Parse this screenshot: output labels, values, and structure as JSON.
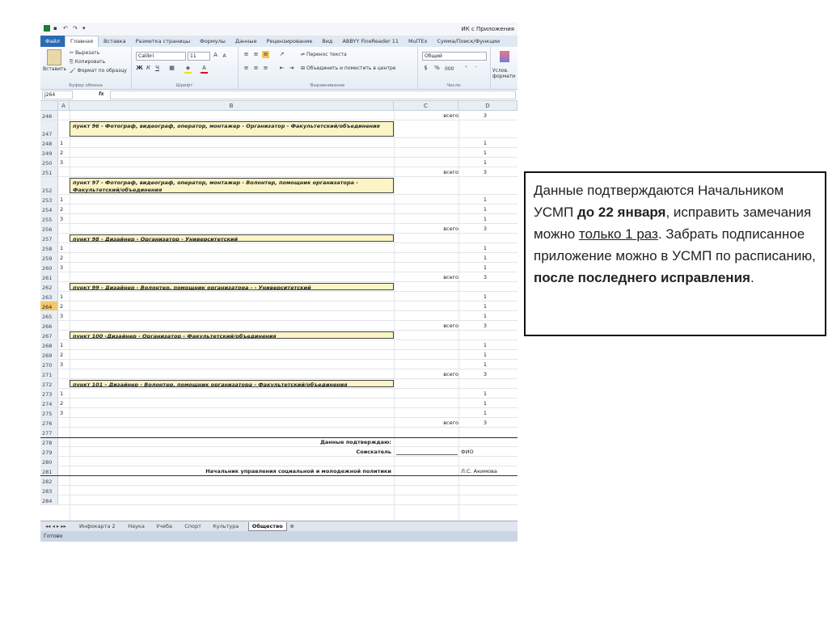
{
  "window": {
    "title": "ИК с Приложения"
  },
  "ribbon": {
    "tabs": [
      "Файл",
      "Главная",
      "Вставка",
      "Разметка страницы",
      "Формулы",
      "Данные",
      "Рецензирование",
      "Вид",
      "ABBYY FineReader 11",
      "MulTEx",
      "Сумма/Поиск/Функции"
    ],
    "active_tab": 1,
    "clipboard": {
      "paste": "Вставить",
      "cut": "Вырезать",
      "copy": "Копировать",
      "format_painter": "Формат по образцу",
      "group": "Буфер обмена"
    },
    "font": {
      "name": "Calibri",
      "size": "11",
      "group": "Шрифт"
    },
    "alignment": {
      "wrap": "Перенос текста",
      "merge": "Объединить и поместить в центре",
      "group": "Выравнивание"
    },
    "number": {
      "format": "Общий",
      "group": "Число",
      "percent": "%",
      "thousands": "000"
    },
    "styles": {
      "label": "Услов. формати"
    }
  },
  "formula_bar": {
    "cell_ref": "J264",
    "fx": "fx"
  },
  "columns": [
    "A",
    "B",
    "C",
    "D"
  ],
  "rows": [
    {
      "n": "246",
      "c": "всего",
      "d": "3"
    },
    {
      "n": "247",
      "hdr": "пункт 96 - Фотограф, видеограф, оператор, монтажер - Организатор - Факультетский/объединения",
      "tall": true
    },
    {
      "n": "248",
      "a": "1",
      "d": "1"
    },
    {
      "n": "249",
      "a": "2",
      "d": "1"
    },
    {
      "n": "250",
      "a": "3",
      "d": "1"
    },
    {
      "n": "251",
      "c": "всего",
      "d": "3"
    },
    {
      "n": "252",
      "hdr": "пункт 97 - Фотограф, видеограф, оператор, монтажер - Волонтер, помощник организатора - Факультетский/объединения",
      "tall": true
    },
    {
      "n": "253",
      "a": "1",
      "d": "1"
    },
    {
      "n": "254",
      "a": "2",
      "d": "1"
    },
    {
      "n": "255",
      "a": "3",
      "d": "1"
    },
    {
      "n": "256",
      "c": "всего",
      "d": "3"
    },
    {
      "n": "257",
      "hdr": "пункт 98 - Дизайнер - Организатор - Университетский"
    },
    {
      "n": "258",
      "a": "1",
      "d": "1"
    },
    {
      "n": "259",
      "a": "2",
      "d": "1"
    },
    {
      "n": "260",
      "a": "3",
      "d": "1"
    },
    {
      "n": "261",
      "c": "всего",
      "d": "3"
    },
    {
      "n": "262",
      "hdr": "пункт 99 - Дизайнер - Волонтер, помощник организатора - - Университетский"
    },
    {
      "n": "263",
      "a": "1",
      "d": "1"
    },
    {
      "n": "264",
      "a": "2",
      "d": "1",
      "sel": true
    },
    {
      "n": "265",
      "a": "3",
      "d": "1"
    },
    {
      "n": "266",
      "c": "всего",
      "d": "3"
    },
    {
      "n": "267",
      "hdr": "пункт 100 -Дизайнер - Организатор - Факультетский/объединения"
    },
    {
      "n": "268",
      "a": "1",
      "d": "1"
    },
    {
      "n": "269",
      "a": "2",
      "d": "1"
    },
    {
      "n": "270",
      "a": "3",
      "d": "1"
    },
    {
      "n": "271",
      "c": "всего",
      "d": "3"
    },
    {
      "n": "272",
      "hdr": "пункт 101 - Дизайнер - Волонтер, помощник организатора - Факультетский/объединения"
    },
    {
      "n": "273",
      "a": "1",
      "d": "1"
    },
    {
      "n": "274",
      "a": "2",
      "d": "1"
    },
    {
      "n": "275",
      "a": "3",
      "d": "1"
    },
    {
      "n": "276",
      "c": "всего",
      "d": "3"
    },
    {
      "n": "277"
    },
    {
      "n": "278",
      "sig": "Данные подтверждаю:"
    },
    {
      "n": "279",
      "sig": "Соискатель",
      "d_text": "ФИО",
      "line": true
    },
    {
      "n": "280"
    },
    {
      "n": "281",
      "sig": "Начальник управления социальной и молодежной политики",
      "d_text": "Л.С. Акимова"
    },
    {
      "n": "282"
    },
    {
      "n": "283"
    },
    {
      "n": "284"
    }
  ],
  "sheet_tabs": [
    "Инфокарта 2",
    "Наука",
    "Учеба",
    "Спорт",
    "Культура",
    "Общество"
  ],
  "active_sheet": 5,
  "status": "Готово",
  "note": {
    "p1": "Данные подтверждаются Начальником УСМП ",
    "p2": "до 22 января",
    "p3": ", исправить замечания можно ",
    "p4": "только 1 раз",
    "p5": ". Забрать подписанное приложение можно в УСМП по расписанию, ",
    "p6": "после последнего исправления",
    "p7": "."
  }
}
